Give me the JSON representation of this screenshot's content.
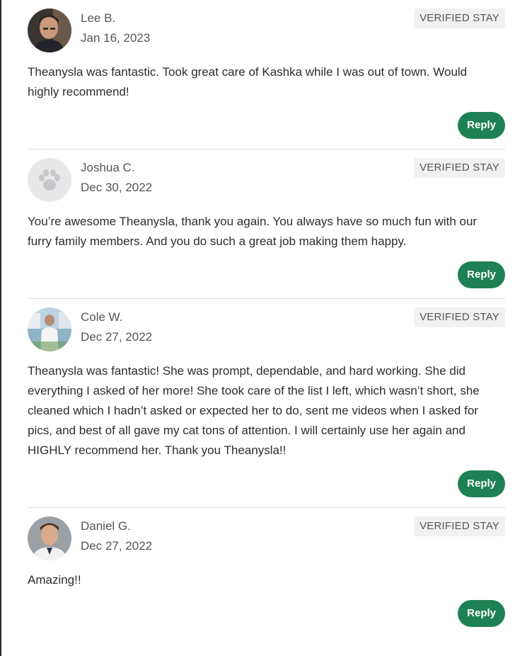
{
  "reviews": [
    {
      "name": "Lee B.",
      "date": "Jan 16, 2023",
      "badge": "VERIFIED STAY",
      "text_lines": [
        "Theanysla was fantastic. Took great care of Kashka while I was out of town. Would",
        "highly recommend!"
      ],
      "reply_label": "Reply",
      "avatar_icon": "profile-photo"
    },
    {
      "name": "Joshua C.",
      "date": "Dec 30, 2022",
      "badge": "VERIFIED STAY",
      "text_lines": [
        "You’re awesome Theanysla, thank you again. You always have so much fun with our",
        "furry family members. And you do such a great job making them happy."
      ],
      "reply_label": "Reply",
      "avatar_icon": "paw-icon"
    },
    {
      "name": "Cole W.",
      "date": "Dec 27, 2022",
      "badge": "VERIFIED STAY",
      "text_lines": [
        "Theanysla was fantastic! She was prompt, dependable, and hard working. She did",
        "everything I asked of her more! She took care of the list I left, which wasn’t short, she",
        "cleaned which I hadn’t asked or expected her to do, sent me videos when I asked for",
        "pics, and best of all gave my cat tons of attention. I will certainly use her again and",
        "HIGHLY recommend her. Thank you Theanysla!!"
      ],
      "reply_label": "Reply",
      "avatar_icon": "profile-photo"
    },
    {
      "name": "Daniel G.",
      "date": "Dec 27, 2022",
      "badge": "VERIFIED STAY",
      "text_lines": [
        "Amazing!!"
      ],
      "reply_label": "Reply",
      "avatar_icon": "profile-photo"
    }
  ],
  "colors": {
    "reply_button": "#1e8155",
    "badge_bg": "#f1f1f1",
    "divider": "#d9d9d9"
  }
}
